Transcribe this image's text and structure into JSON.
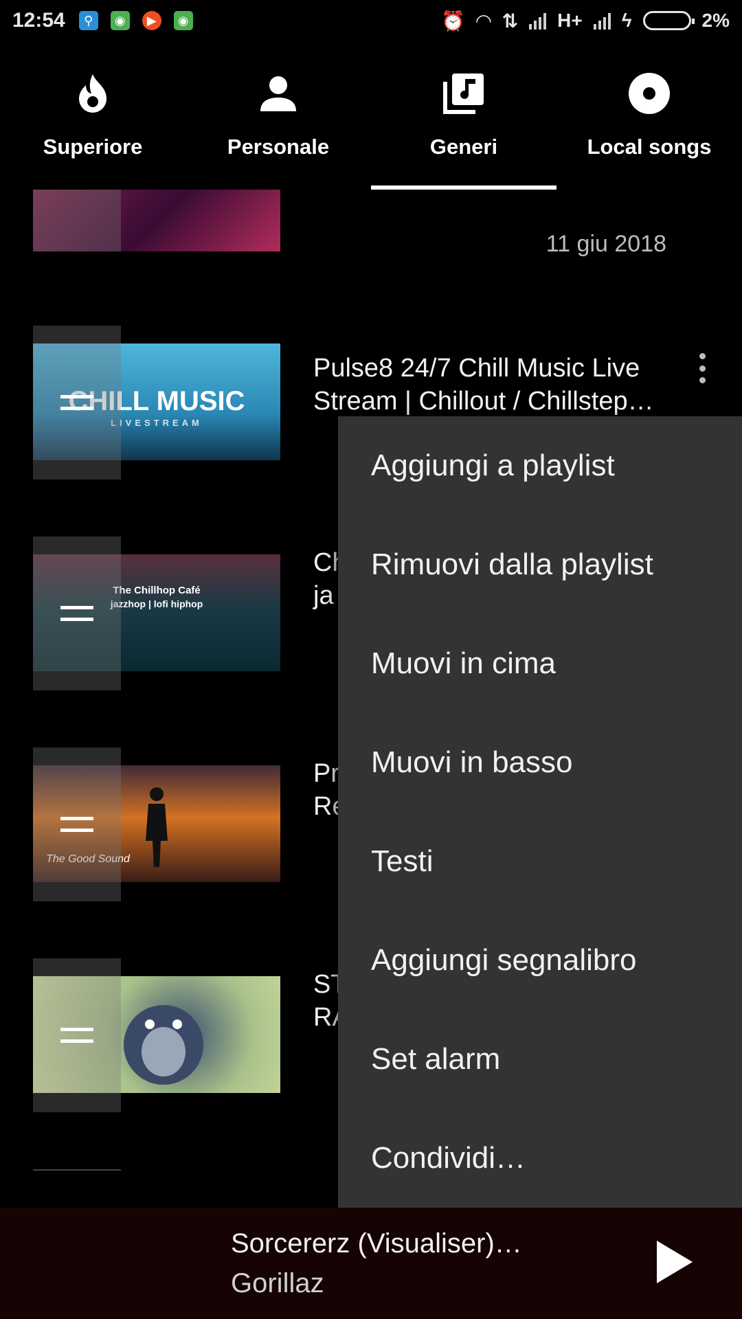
{
  "status": {
    "time": "12:54",
    "network": "H+",
    "battery": "2%"
  },
  "tabs": [
    {
      "label": "Superiore",
      "icon": "flame-icon"
    },
    {
      "label": "Personale",
      "icon": "person-icon"
    },
    {
      "label": "Generi",
      "icon": "music-library-icon",
      "active": true
    },
    {
      "label": "Local songs",
      "icon": "disc-icon"
    }
  ],
  "list": {
    "items": [
      {
        "title": "",
        "date": "11 giu 2018"
      },
      {
        "title": "Pulse8 24/7 Chill Music Live\nStream | Chillout / Chillstep…",
        "thumb_text": "CHILL MUSIC",
        "thumb_sub": "LIVESTREAM"
      },
      {
        "title": "Ch\nja",
        "thumb_text": "The Chillhop Café",
        "thumb_sub": "jazzhop | lofi hiphop"
      },
      {
        "title": "Pr\nRe",
        "thumb_text": "The Good Sound"
      },
      {
        "title": "ST\nRA"
      }
    ]
  },
  "menu": {
    "items": [
      "Aggiungi a playlist",
      "Rimuovi dalla playlist",
      "Muovi in cima",
      "Muovi in basso",
      "Testi",
      "Aggiungi segnalibro",
      "Set alarm",
      "Condividi…"
    ]
  },
  "player": {
    "title": "Sorcererz (Visualiser)…",
    "artist": "Gorillaz"
  }
}
